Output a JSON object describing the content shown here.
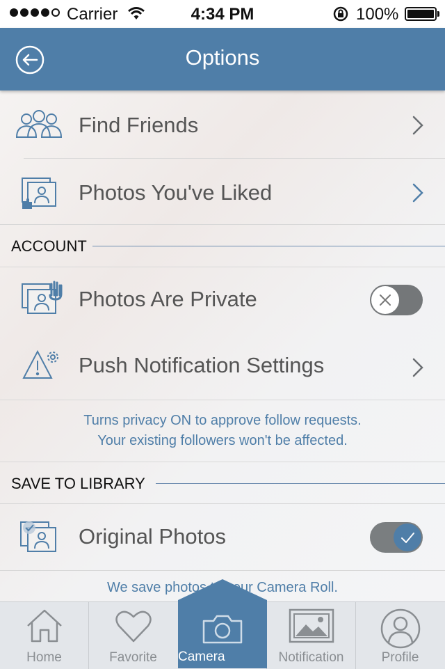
{
  "status_bar": {
    "carrier": "Carrier",
    "time": "4:34 PM",
    "battery": "100%"
  },
  "navbar": {
    "title": "Options"
  },
  "menu": {
    "find_friends": "Find Friends",
    "photos_liked": "Photos You've Liked"
  },
  "account": {
    "header": "ACCOUNT",
    "photos_private": "Photos Are Private",
    "photos_private_on": false,
    "push_settings": "Push Notification Settings",
    "note_line1": "Turns privacy ON to approve follow requests.",
    "note_line2": "Your existing followers won't be affected."
  },
  "save_library": {
    "header": "SAVE TO LIBRARY",
    "original_photos": "Original Photos",
    "original_photos_on": true,
    "note": "We save photos to your Camera Roll."
  },
  "tabs": [
    {
      "label": "Home",
      "icon": "home-icon"
    },
    {
      "label": "Favorite",
      "icon": "heart-icon"
    },
    {
      "label": "Camera",
      "icon": "camera-icon"
    },
    {
      "label": "Notification",
      "icon": "image-icon"
    },
    {
      "label": "Profile",
      "icon": "profile-icon"
    }
  ],
  "colors": {
    "accent": "#4f7ea8",
    "text": "#555555",
    "tab_inactive": "#8a8e92"
  }
}
